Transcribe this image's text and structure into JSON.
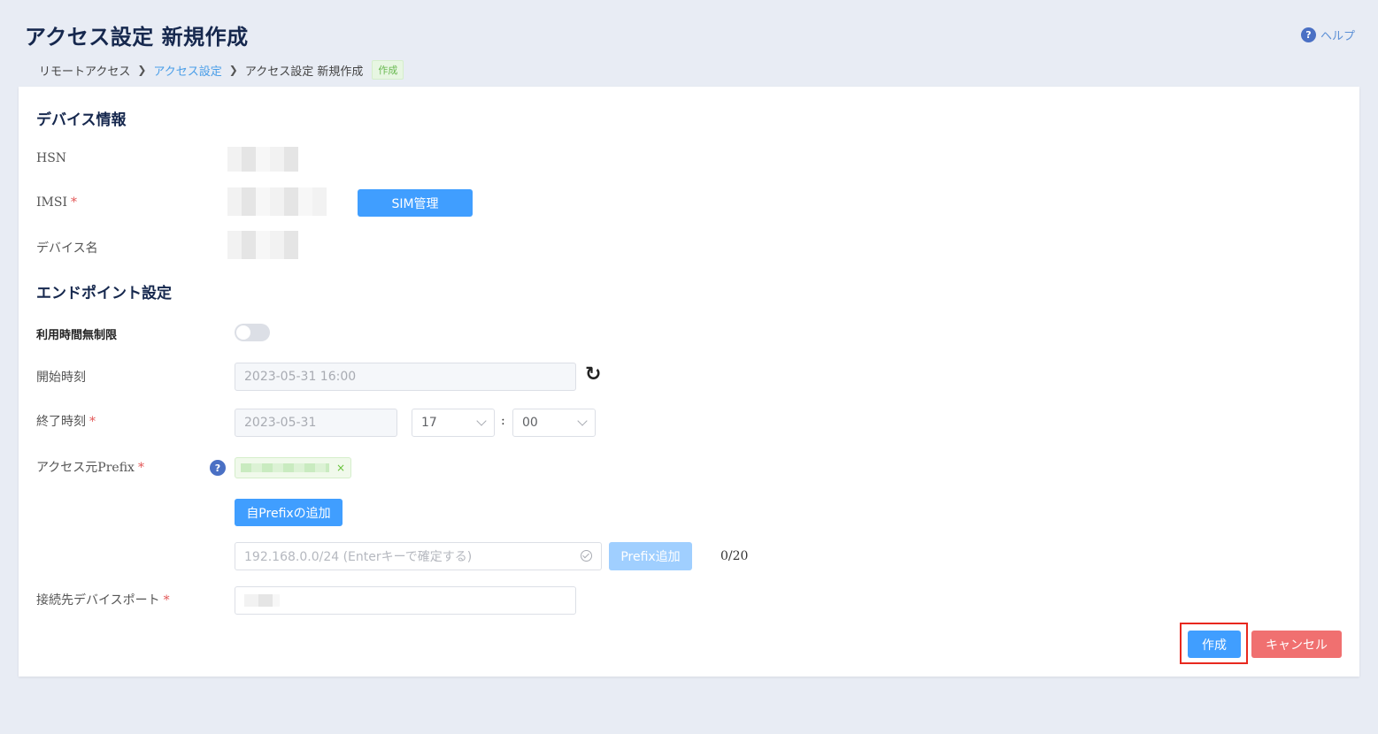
{
  "page": {
    "title": "アクセス設定 新規作成",
    "help_label": "ヘルプ",
    "help_icon": "question-circle-icon"
  },
  "breadcrumb": {
    "items": [
      "リモートアクセス",
      "アクセス設定",
      "アクセス設定 新規作成"
    ],
    "tag": "作成"
  },
  "device": {
    "section_title": "デバイス情報",
    "hsn_label": "HSN",
    "imsi_label": "IMSI",
    "sim_button": "SIM管理",
    "device_name_label": "デバイス名"
  },
  "endpoint": {
    "section_title": "エンドポイント設定",
    "unlimited_label": "利用時間無制限",
    "unlimited_on": false,
    "start_label": "開始時刻",
    "start_value": "2023-05-31 16:00",
    "end_label": "終了時刻",
    "end_date": "2023-05-31",
    "end_hour": "17",
    "time_sep": ":",
    "end_minute": "00",
    "prefix_label": "アクセス元Prefix",
    "prefix_tag_close": "×",
    "add_own_prefix_button": "自Prefixの追加",
    "prefix_input_placeholder": "192.168.0.0/24 (Enterキーで確定する)",
    "prefix_add_button": "Prefix追加",
    "prefix_counter": "0/20",
    "port_label": "接続先デバイスポート",
    "required_mark": "*"
  },
  "actions": {
    "create": "作成",
    "cancel": "キャンセル"
  },
  "colors": {
    "primary": "#409eff",
    "danger": "#f07070",
    "title": "#16284e",
    "highlight": "#e8281e"
  }
}
